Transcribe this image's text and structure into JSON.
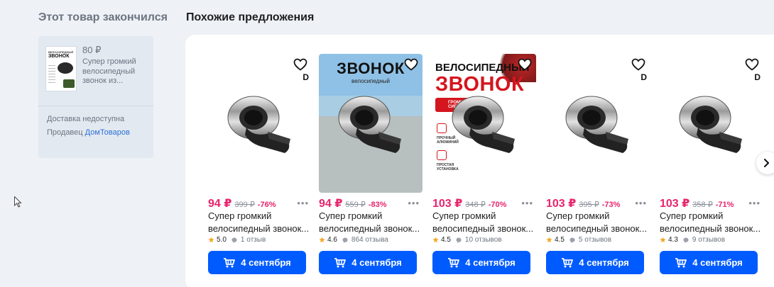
{
  "out_of_stock": {
    "title": "Этот товар закончился",
    "price": "80 ₽",
    "name": "Супер громкий велосипедный звонок из...",
    "thumb_line1": "ВЕЛОСИПЕДНЫЙ",
    "thumb_line2": "ЗВОНОК",
    "delivery": "Доставка недоступна",
    "seller_label": "Продавец",
    "seller_name": "ДомТоваров"
  },
  "similar": {
    "title": "Похожие предложения",
    "products": [
      {
        "price": "94 ₽",
        "old_price": "399 ₽",
        "discount": "-76%",
        "name_l1": "Супер громкий",
        "name_l2": "велосипедный звонок...",
        "rating": "5.0",
        "reviews": "1 отзыв",
        "button": "4 сентября",
        "badge": "D",
        "image": "plain"
      },
      {
        "price": "94 ₽",
        "old_price": "559 ₽",
        "discount": "-83%",
        "name_l1": "Супер громкий",
        "name_l2": "велосипедный звонок...",
        "rating": "4.6",
        "reviews": "864 отзыва",
        "button": "4 сентября",
        "badge": "",
        "image": "photo",
        "img_title": "ЗВОНОК",
        "img_sub": "велосипедный"
      },
      {
        "price": "103 ₽",
        "old_price": "348 ₽",
        "discount": "-70%",
        "name_l1": "Супер громкий",
        "name_l2": "велосипедный звонок...",
        "rating": "4.5",
        "reviews": "10 отзывов",
        "button": "4 сентября",
        "badge": "",
        "image": "poster",
        "img_title": "ВЕЛОСИПЕДНЫЙ",
        "img_sub": "ЗВОНОК",
        "img_badge": "ГРОМКИЙ СИГНАЛ",
        "img_feature1": "ПРОЧНЫЙ АЛЮМИНИЙ",
        "img_feature2": "ПРОСТАЯ УСТАНОВКА"
      },
      {
        "price": "103 ₽",
        "old_price": "395 ₽",
        "discount": "-73%",
        "name_l1": "Супер громкий",
        "name_l2": "велосипедный звонок...",
        "rating": "4.5",
        "reviews": "5 отзывов",
        "button": "4 сентября",
        "badge": "D",
        "image": "plain"
      },
      {
        "price": "103 ₽",
        "old_price": "358 ₽",
        "discount": "-71%",
        "name_l1": "Супер громкий",
        "name_l2": "велосипедный звонок...",
        "rating": "4.3",
        "reviews": "9 отзывов",
        "button": "4 сентября",
        "badge": "D",
        "image": "plain"
      }
    ]
  },
  "colors": {
    "accent": "#005bff",
    "price": "#e8246c",
    "background": "#eef1f5",
    "rating_star": "#f5a623"
  },
  "icons": {
    "favorite": "heart-icon",
    "more": "more-dots-icon",
    "cart": "cart-icon",
    "star": "star-icon",
    "review": "chat-bubble-icon",
    "next": "chevron-right-icon"
  }
}
